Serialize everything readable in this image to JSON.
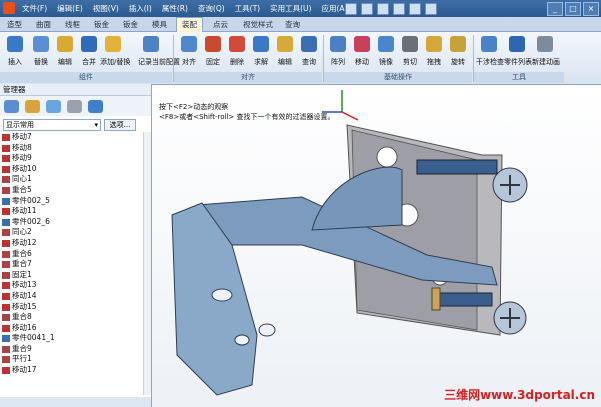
{
  "menu": [
    "文件(F)",
    "编辑(E)",
    "视图(V)",
    "插入(I)",
    "属性(R)",
    "查询(Q)",
    "工具(T)",
    "实用工具(U)",
    "应用(A)"
  ],
  "tabs": [
    "造型",
    "曲面",
    "线框",
    "钣金",
    "钣金",
    "模具",
    "装配",
    "点云",
    "视觉样式",
    "查询"
  ],
  "active_tab": "装配",
  "ribbon_buttons": [
    "插入",
    "替换",
    "编辑",
    "合并",
    "添加/替换",
    "记录当前配置",
    "对齐",
    "固定",
    "删除",
    "求解",
    "编辑",
    "查询",
    "阵列",
    "移动",
    "镜像",
    "剪切",
    "拖拽",
    "旋转",
    "干涉检查",
    "零件列表",
    "新建动画"
  ],
  "group_labels": [
    "组件",
    "对齐",
    "基础操作",
    "工具"
  ],
  "left_pane": {
    "title": "管理器",
    "filter_value": "显示常用",
    "options_button": "选项...",
    "tree_items": [
      "移动7",
      "移动8",
      "移动9",
      "移动10",
      "同心1",
      "重合5",
      "零件002_5",
      "移动11",
      "零件002_6",
      "同心2",
      "移动12",
      "重合6",
      "重合7",
      "固定1",
      "移动13",
      "移动14",
      "移动15",
      "重合8",
      "移动16",
      "零件0041_1",
      "重合9",
      "平行1",
      "移动17"
    ]
  },
  "viewport": {
    "hint_line1": "按下<F2>动态的观察",
    "hint_line2": "<F8>或者<Shift-roll> 查找下一个有效的过滤器设置。",
    "watermark": "三维网www.3dportal.cn"
  }
}
